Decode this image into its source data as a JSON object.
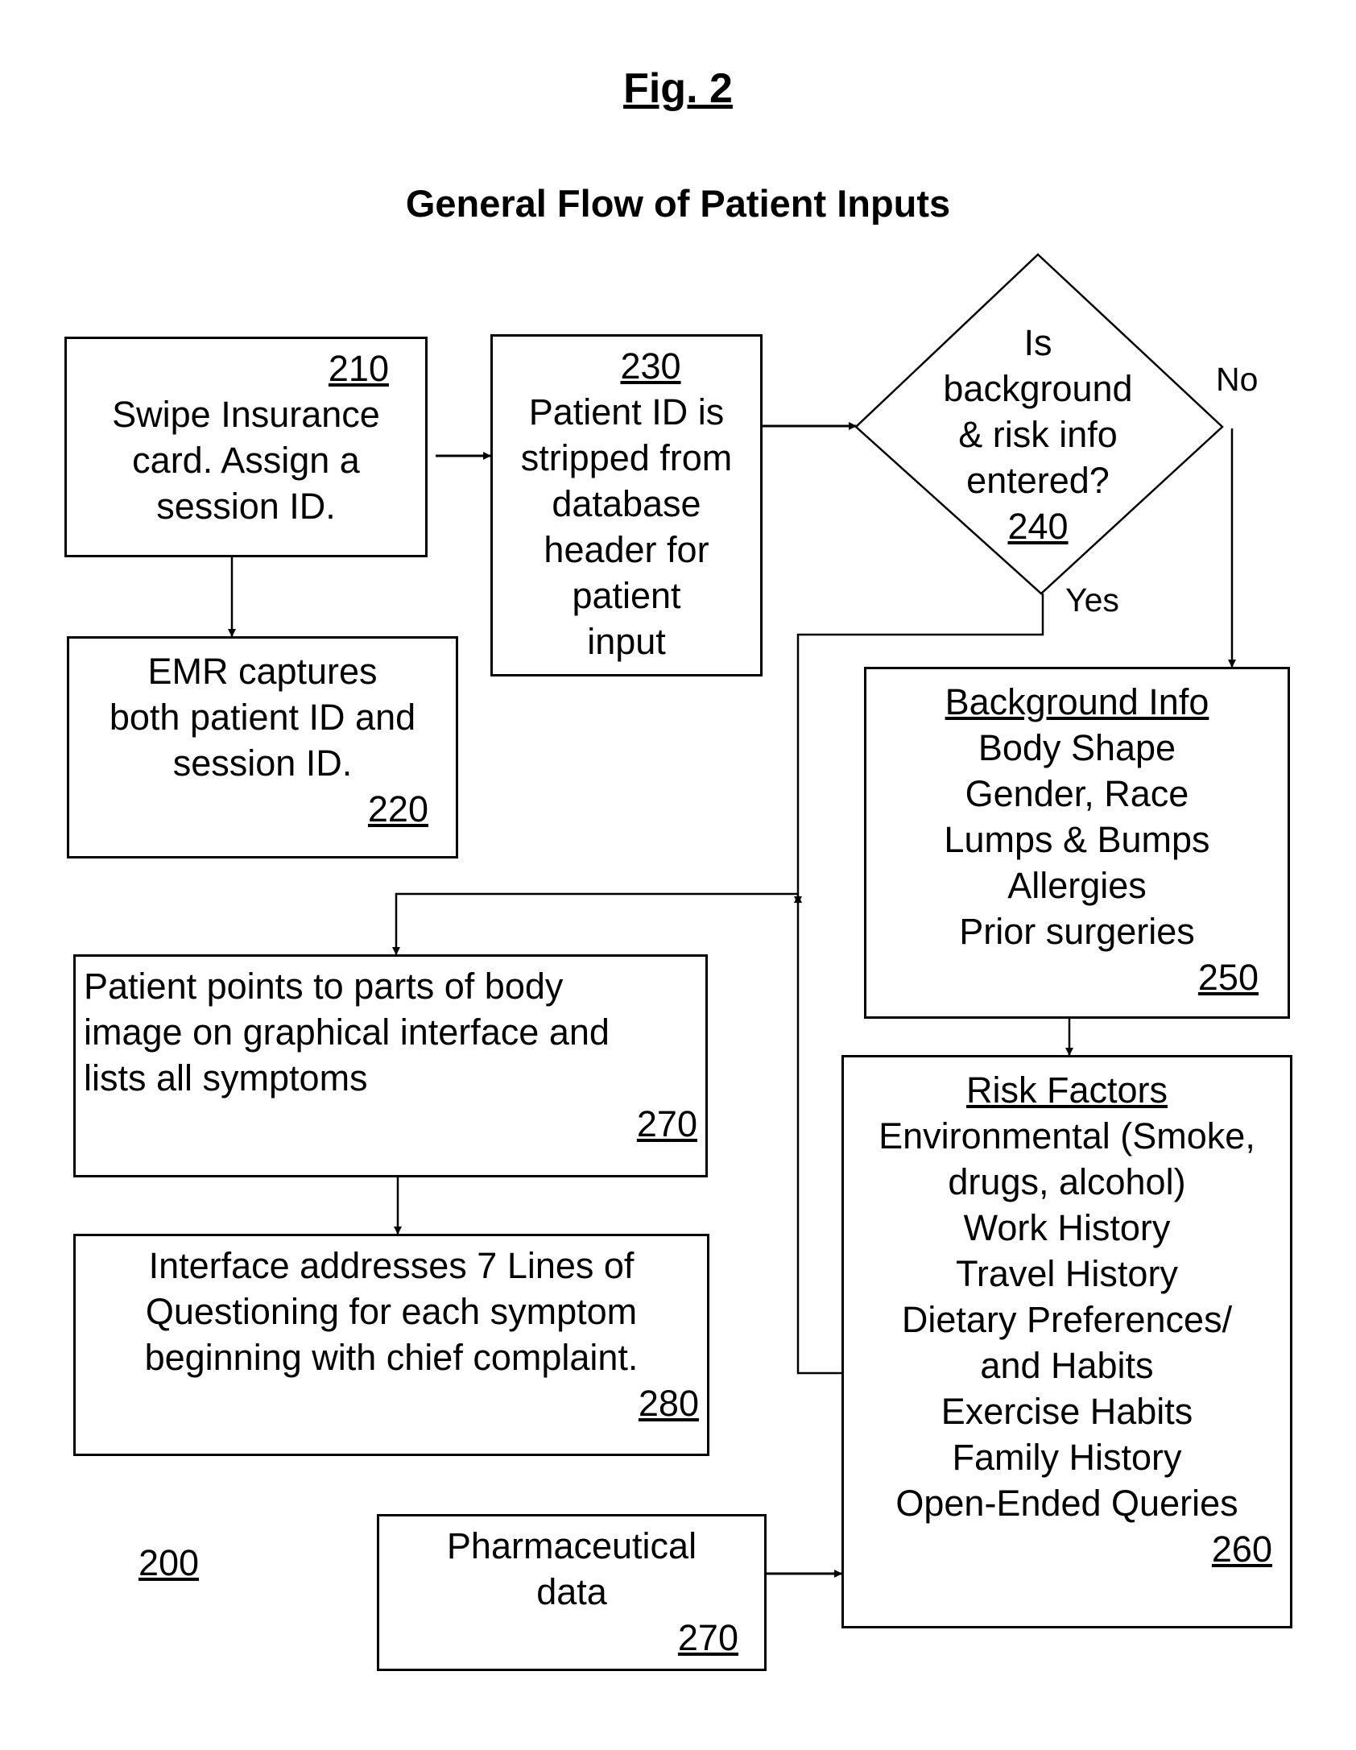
{
  "figure_label": "Fig. 2",
  "title": "General Flow of Patient Inputs",
  "diagram_ref": "200",
  "nodes": {
    "n210": {
      "ref": "210",
      "lines": [
        "Swipe Insurance",
        "card. Assign a",
        "session ID."
      ]
    },
    "n220": {
      "ref": "220",
      "lines": [
        "EMR captures",
        "both patient ID and",
        "session ID."
      ]
    },
    "n230": {
      "ref": "230",
      "lines": [
        "Patient ID is",
        "stripped from",
        "database",
        "header for",
        "patient",
        "input"
      ]
    },
    "n240": {
      "ref": "240",
      "lines": [
        "Is",
        "background",
        "& risk info",
        "entered?"
      ]
    },
    "n250": {
      "ref": "250",
      "heading": "Background Info",
      "lines": [
        "Body Shape",
        "Gender, Race",
        "Lumps & Bumps",
        "Allergies",
        "Prior surgeries"
      ]
    },
    "n260": {
      "ref": "260",
      "heading": "Risk Factors",
      "lines": [
        "Environmental (Smoke,",
        "drugs, alcohol)",
        "Work History",
        "Travel History",
        "Dietary Preferences/",
        "and Habits",
        "Exercise Habits",
        "Family History",
        "Open-Ended Queries"
      ]
    },
    "n270a": {
      "ref": "270",
      "lines": [
        "Patient points to parts of body",
        "image on graphical interface and",
        "lists all symptoms"
      ]
    },
    "n280": {
      "ref": "280",
      "lines": [
        "Interface addresses 7 Lines of",
        "Questioning for each symptom",
        "beginning with chief complaint."
      ]
    },
    "n270b": {
      "ref": "270",
      "lines": [
        "Pharmaceutical",
        "data"
      ]
    }
  },
  "edge_labels": {
    "no": "No",
    "yes": "Yes"
  }
}
